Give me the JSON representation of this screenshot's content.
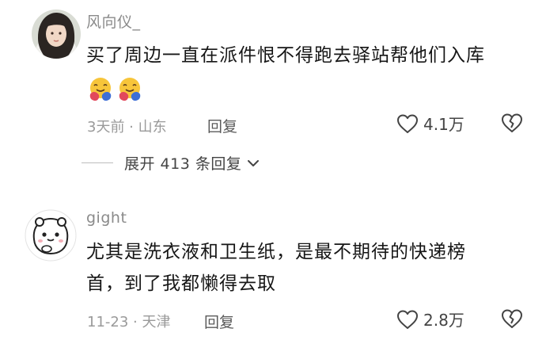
{
  "comments": [
    {
      "username": "风向仪_",
      "text": "买了周边一直在派件恨不得跑去驿站帮他们入库",
      "emoji_icons": [
        "hug-emoji-icon",
        "hug-emoji-icon"
      ],
      "time_location": "3天前 · 山东",
      "reply_label": "回复",
      "like_count": "4.1万",
      "expand_label": "展开 413 条回复"
    },
    {
      "username": "gight",
      "text_line1": "尤其是洗衣液和卫生纸，是最不期待的快递榜",
      "text_line2": "首，到了我都懒得去取",
      "time_location": "11-23 · 天津",
      "reply_label": "回复",
      "like_count": "2.8万"
    }
  ],
  "icons": {
    "like": "heart-outline-icon",
    "dislike": "broken-heart-icon",
    "expand": "chevron-down-icon"
  },
  "colors": {
    "username": "#8a8a8a",
    "body_text": "#161616",
    "meta": "#9a9a9a",
    "emoji_face": "#f7c53a",
    "emoji_hands": "#e2485c"
  }
}
